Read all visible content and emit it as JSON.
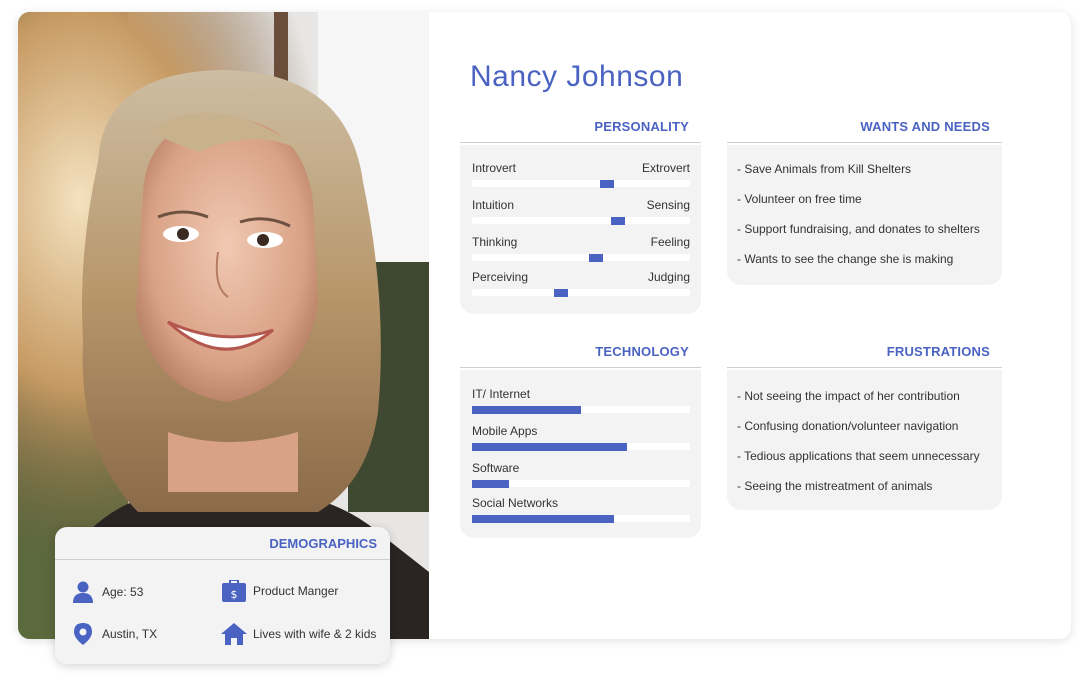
{
  "persona": {
    "name": "Nancy Johnson"
  },
  "photo": {
    "alt": ""
  },
  "personality": {
    "title": "PERSONALITY",
    "scales": [
      {
        "left": "Introvert",
        "right": "Extrovert",
        "value": 0.62
      },
      {
        "left": "Intuition",
        "right": "Sensing",
        "value": 0.67
      },
      {
        "left": "Thinking",
        "right": "Feeling",
        "value": 0.57
      },
      {
        "left": "Perceiving",
        "right": "Judging",
        "value": 0.41
      }
    ]
  },
  "technology": {
    "title": "TECHNOLOGY",
    "items": [
      {
        "label": "IT/ Internet",
        "value": 0.5
      },
      {
        "label": "Mobile Apps",
        "value": 0.71
      },
      {
        "label": "Software",
        "value": 0.17
      },
      {
        "label": "Social Networks",
        "value": 0.65
      }
    ]
  },
  "wants": {
    "title": "WANTS AND NEEDS",
    "items": [
      "- Save Animals from Kill Shelters",
      "- Volunteer on free time",
      "- Support fundraising, and donates to shelters",
      "- Wants to see the change she is making"
    ]
  },
  "frustrations": {
    "title": "FRUSTRATIONS",
    "items": [
      "- Not seeing the impact of her contribution",
      "- Confusing donation/volunteer navigation",
      "- Tedious applications that seem unnecessary",
      "- Seeing the mistreatment of animals"
    ]
  },
  "demographics": {
    "title": "DEMOGRAPHICS",
    "age": "Age: 53",
    "job": "Product Manger",
    "location": "Austin, TX",
    "family": "Lives with wife & 2 kids",
    "icons": {
      "age": "person-icon",
      "job": "briefcase-dollar-icon",
      "location": "map-pin-icon",
      "family": "house-icon"
    }
  },
  "colors": {
    "accent": "#4a63c2",
    "panel": "#f3f3f3",
    "track": "#ffffff"
  }
}
